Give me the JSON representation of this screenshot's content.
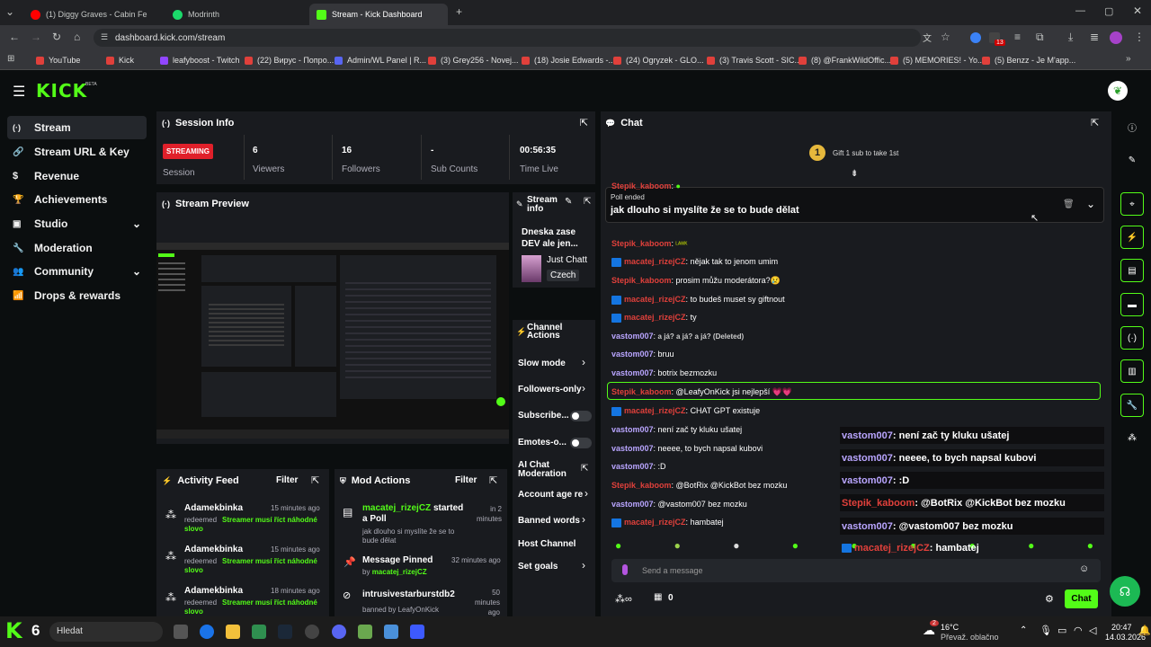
{
  "browser": {
    "tabs": [
      {
        "title": "(1) Diggy Graves - Cabin Fe",
        "color": "#ff0000"
      },
      {
        "title": "Modrinth",
        "color": "#1bd96a"
      },
      {
        "title": "Stream - Kick Dashboard",
        "color": "#53fc18"
      }
    ],
    "url": "dashboard.kick.com/stream",
    "bookmarks": [
      "YouTube",
      "Kick",
      "leafyboost - Twitch",
      "(22) Вирус - Попро...",
      "Admin/WL Panel | R...",
      "(3) Grey256 - Novej...",
      "(18) Josie Edwards -...",
      "(24) Ogryzek - GLO...",
      "(3) Travis Scott - SIC...",
      "(8) @FrankWildOffic...",
      "(5) MEMORIES! - Yo...",
      "(5) Benzz - Je M'app..."
    ],
    "ext_badge": "13"
  },
  "kick": {
    "logo": "KICK",
    "logo_beta": "BETA",
    "nav": [
      {
        "label": "Stream",
        "icon": "broadcast-icon",
        "glyph": "(·)"
      },
      {
        "label": "Stream URL & Key",
        "icon": "link-icon",
        "glyph": "🔗"
      },
      {
        "label": "Revenue",
        "icon": "dollar-icon",
        "glyph": "$"
      },
      {
        "label": "Achievements",
        "icon": "trophy-icon",
        "glyph": "🏆"
      },
      {
        "label": "Studio",
        "icon": "studio-icon",
        "glyph": "▣"
      },
      {
        "label": "Moderation",
        "icon": "wrench-icon",
        "glyph": "🔧"
      },
      {
        "label": "Community",
        "icon": "users-icon",
        "glyph": "👥"
      },
      {
        "label": "Drops & rewards",
        "icon": "chart-icon",
        "glyph": "📶"
      }
    ],
    "session": {
      "title": "Session Info",
      "status": "STREAMING",
      "status_label": "Session",
      "stats": [
        {
          "value": "6",
          "label": "Viewers"
        },
        {
          "value": "16",
          "label": "Followers"
        },
        {
          "value": "-",
          "label": "Sub Counts"
        },
        {
          "value": "00:56:35",
          "label": "Time Live"
        }
      ]
    },
    "preview_title": "Stream Preview",
    "stream_info": {
      "title": "Stream info",
      "stream_title": "Dneska zase DEV ale jen...",
      "category": "Just Chatt",
      "language": "Czech"
    },
    "channel_actions": {
      "title": "Channel Actions",
      "items": [
        {
          "label": "Slow mode",
          "control": "arrow"
        },
        {
          "label": "Followers-only",
          "control": "arrow"
        },
        {
          "label": "Subscribe...",
          "control": "toggle"
        },
        {
          "label": "Emotes-o...",
          "control": "toggle"
        },
        {
          "label": "AI Chat Moderation",
          "control": "external"
        },
        {
          "label": "Account age re",
          "control": "arrow"
        },
        {
          "label": "Banned words",
          "control": "arrow"
        },
        {
          "label": "Host Channel",
          "control": "none"
        },
        {
          "label": "Set goals",
          "control": "arrow"
        }
      ]
    },
    "activity": {
      "title": "Activity Feed",
      "filter": "Filter",
      "items": [
        {
          "user": "Adamekbinka",
          "time": "15 minutes ago",
          "action": "redeemed",
          "reward": "Streamer musí říct náhodné slovo"
        },
        {
          "user": "Adamekbinka",
          "time": "15 minutes ago",
          "action": "redeemed",
          "reward": "Streamer musí říct náhodné slovo"
        },
        {
          "user": "Adamekbinka",
          "time": "18 minutes ago",
          "action": "redeemed",
          "reward": "Streamer musí říct náhodné slovo"
        }
      ]
    },
    "mod_actions": {
      "title": "Mod Actions",
      "filter": "Filter",
      "items": [
        {
          "user": "macatej_rizejCZ",
          "text": "started a Poll",
          "detail": "jak dlouho si myslíte že se to bude dělat",
          "time": "in 2 minutes"
        },
        {
          "user": "",
          "text": "Message Pinned",
          "by_prefix": "by",
          "by": "macatej_rizejCZ",
          "time": "32 minutes ago"
        },
        {
          "user": "intrusivestarburstdb2",
          "text": "",
          "detail": "banned by LeafyOnKick",
          "time": "50 minutes ago"
        }
      ]
    },
    "chat": {
      "title": "Chat",
      "gift_rank": "1",
      "gift_text": "Gift 1 sub to take 1st",
      "poll_label": "Poll ended",
      "poll_question": "jak dlouho si myslíte že se to bude dělat",
      "messages": [
        {
          "user": "Stepik_kaboom",
          "color": "red",
          "badge": false,
          "text": "",
          "y": 0
        },
        {
          "user": "Stepik_kaboom",
          "color": "red",
          "badge": false,
          "text": "",
          "emote": true
        },
        {
          "user": "macatej_rizejCZ",
          "color": "red",
          "badge": true,
          "text": "nějak tak to jenom umim"
        },
        {
          "user": "Stepik_kaboom",
          "color": "red",
          "badge": false,
          "text": "prosim můžu moderátora?😢"
        },
        {
          "user": "macatej_rizejCZ",
          "color": "red",
          "badge": true,
          "text": "to budeš muset sy giftnout"
        },
        {
          "user": "macatej_rizejCZ",
          "color": "red",
          "badge": true,
          "text": "ty"
        },
        {
          "user": "vastom007",
          "color": "purple",
          "badge": false,
          "text": "a já? a já? a já? (Deleted)",
          "deleted": true
        },
        {
          "user": "vastom007",
          "color": "purple",
          "badge": false,
          "text": "bruu"
        },
        {
          "user": "vastom007",
          "color": "purple",
          "badge": false,
          "text": "botrix bezmozku"
        },
        {
          "user": "Stepik_kaboom",
          "color": "red",
          "badge": false,
          "text": "@LeafyOnKick jsi nejlepší 💗💗",
          "highlight": true
        },
        {
          "user": "macatej_rizejCZ",
          "color": "red",
          "badge": true,
          "text": "CHAT GPT existuje"
        },
        {
          "user": "vastom007",
          "color": "purple",
          "badge": false,
          "text": "není zač ty kluku ušatej"
        },
        {
          "user": "vastom007",
          "color": "purple",
          "badge": false,
          "text": "neeee, to bych napsal kubovi"
        },
        {
          "user": "vastom007",
          "color": "purple",
          "badge": false,
          "text": ":D"
        },
        {
          "user": "Stepik_kaboom",
          "color": "red",
          "badge": false,
          "text": "@BotRix @KickBot bez mozku"
        },
        {
          "user": "vastom007",
          "color": "purple",
          "badge": false,
          "text": "@vastom007 bez mozku"
        },
        {
          "user": "macatej_rizejCZ",
          "color": "red",
          "badge": true,
          "text": "hambatej"
        }
      ],
      "overlay": [
        {
          "user": "vastom007",
          "color": "purple",
          "text": "není zač ty kluku ušatej"
        },
        {
          "user": "vastom007",
          "color": "purple",
          "text": "neeee, to bych napsal kubovi"
        },
        {
          "user": "vastom007",
          "color": "purple",
          "text": ":D"
        },
        {
          "user": "Stepik_kaboom",
          "color": "red",
          "text": "@BotRix @KickBot bez mozku"
        },
        {
          "user": "vastom007",
          "color": "purple",
          "text": "@vastom007 bez mozku"
        },
        {
          "user": "macatej_rizejCZ",
          "color": "red",
          "text": "hambatej",
          "badge": true
        }
      ],
      "input_placeholder": "Send a message",
      "viewers_icon_count": "0",
      "send": "Chat"
    }
  },
  "taskbar": {
    "logo_num": "6",
    "search": "Hledat",
    "weather_temp": "16°C",
    "weather_text": "Převaž. oblačno",
    "weather_badge": "2",
    "time": "20:47",
    "date": "14.03.2026"
  }
}
